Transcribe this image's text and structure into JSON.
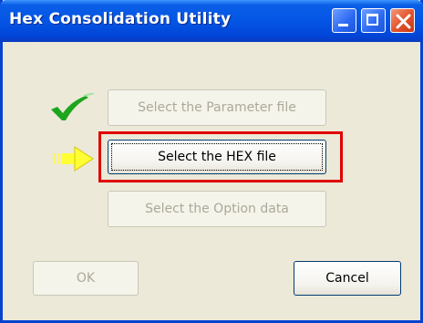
{
  "window": {
    "title": "Hex Consolidation Utility",
    "controls": [
      "minimize",
      "maximize",
      "close"
    ]
  },
  "buttons": {
    "parameter": {
      "label": "Select the Parameter file",
      "state": "disabled"
    },
    "hex": {
      "label": "Select the HEX file",
      "state": "focused"
    },
    "option": {
      "label": "Select the Option data",
      "state": "disabled"
    },
    "ok": {
      "label": "OK",
      "state": "disabled"
    },
    "cancel": {
      "label": "Cancel",
      "state": "enabled"
    }
  },
  "indicators": {
    "parameter_done": "checkmark-icon",
    "current_step": "arrow-right-icon"
  },
  "colors": {
    "titlebar": "#0455e5",
    "highlight": "#e00000",
    "check": "#1ea51e",
    "arrow": "#ffff33"
  }
}
